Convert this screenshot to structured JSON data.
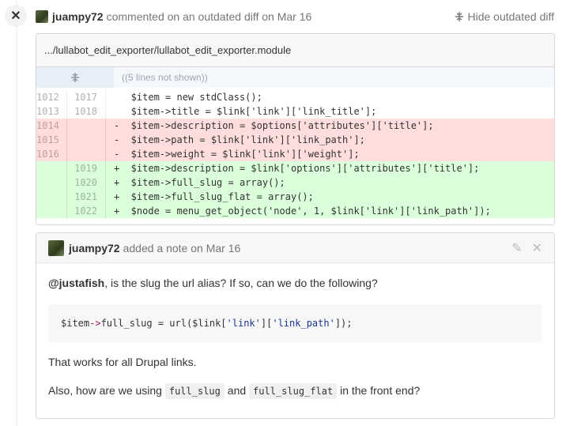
{
  "timeline": {
    "badge_icon": "close-icon"
  },
  "header": {
    "author": "juampy72",
    "action_text": "commented on an outdated diff on Mar 16",
    "hide_label": "Hide outdated diff"
  },
  "file": {
    "path": ".../lullabot_edit_exporter/lullabot_edit_exporter.module",
    "expander_text": "((5 lines not shown))",
    "lines": [
      {
        "type": "ctx",
        "old": "1012",
        "new": "1017",
        "marker": " ",
        "code": "  $item = new stdClass();"
      },
      {
        "type": "ctx",
        "old": "1013",
        "new": "1018",
        "marker": " ",
        "code": "  $item->title = $link['link']['link_title'];"
      },
      {
        "type": "del",
        "old": "1014",
        "new": "",
        "marker": "-",
        "code": "  $item->description = $options['attributes']['title'];"
      },
      {
        "type": "del",
        "old": "1015",
        "new": "",
        "marker": "-",
        "code": "  $item->path = $link['link']['link_path'];"
      },
      {
        "type": "del",
        "old": "1016",
        "new": "",
        "marker": "-",
        "code": "  $item->weight = $link['link']['weight'];"
      },
      {
        "type": "add",
        "old": "",
        "new": "1019",
        "marker": "+",
        "code": "  $item->description = $link['options']['attributes']['title'];"
      },
      {
        "type": "add",
        "old": "",
        "new": "1020",
        "marker": "+",
        "code": "  $item->full_slug = array();"
      },
      {
        "type": "add",
        "old": "",
        "new": "1021",
        "marker": "+",
        "code": "  $item->full_slug_flat = array();"
      },
      {
        "type": "add",
        "old": "",
        "new": "1022",
        "marker": "+",
        "code": "  $node = menu_get_object('node', 1, $link['link']['link_path']);"
      }
    ]
  },
  "note": {
    "author": "juampy72",
    "action_text": "added a note on Mar 16",
    "mention": "@justafish",
    "para1_rest": ", is the slug the url alias? If so, can we do the following?",
    "code": {
      "var": "$item",
      "arrow": "->",
      "prop": "full_slug = url($link[",
      "s1": "'link'",
      "mid": "][",
      "s2": "'link_path'",
      "end": "]);"
    },
    "para2": "That works for all Drupal links.",
    "para3_a": "Also, how are we using ",
    "para3_code1": "full_slug",
    "para3_b": " and ",
    "para3_code2": "full_slug_flat",
    "para3_c": " in the front end?"
  }
}
